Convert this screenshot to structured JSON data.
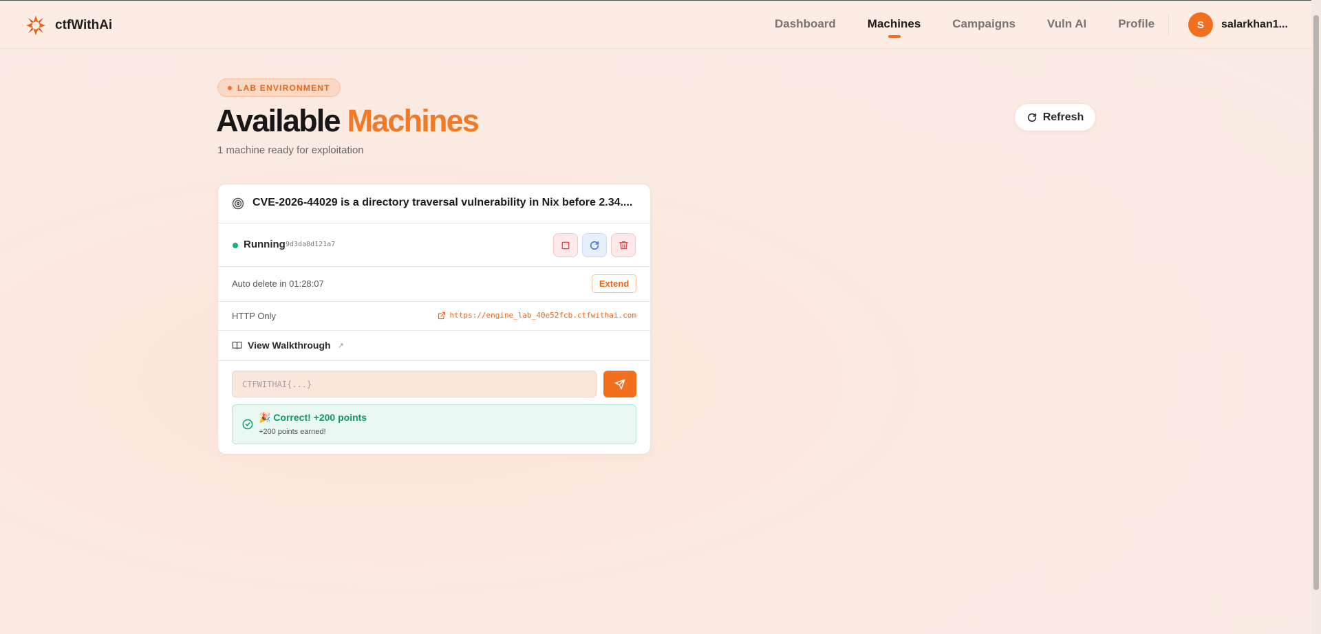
{
  "brand": {
    "name": "ctfWithAi"
  },
  "nav": {
    "items": [
      {
        "label": "Dashboard",
        "active": false
      },
      {
        "label": "Machines",
        "active": true
      },
      {
        "label": "Campaigns",
        "active": false
      },
      {
        "label": "Vuln AI",
        "active": false
      },
      {
        "label": "Profile",
        "active": false
      }
    ],
    "user": {
      "initial": "S",
      "name": "salarkhan1..."
    }
  },
  "header": {
    "badge": "LAB ENVIRONMENT",
    "title_main": "Available",
    "title_accent": "Machines",
    "subtitle": "1 machine ready for exploitation",
    "refresh_label": "Refresh"
  },
  "machine": {
    "title": "CVE-2026-44029 is a directory traversal vulnerability in Nix before 2.34....",
    "status": "Running",
    "id": "9d3da8d121a7",
    "timer_text": "Auto delete in 01:28:07",
    "extend_label": "Extend",
    "access_type": "HTTP Only",
    "url": "https://engine_lab_40e52fcb.ctfwithai.com",
    "walkthrough_label": "View Walkthrough",
    "walkthrough_arrow": "↗",
    "flag_placeholder": "CTFWITHAI{...}",
    "success_title": "🎉 Correct! +200 points",
    "success_sub": "+200 points earned!"
  },
  "colors": {
    "accent": "#f26f1e",
    "status_running": "#17b07c",
    "success": "#0e9a67"
  },
  "icons": [
    "logo-icon",
    "refresh-icon",
    "target-icon",
    "stop-icon",
    "restart-icon",
    "trash-icon",
    "external-link-icon",
    "book-icon",
    "send-icon",
    "check-circle-icon"
  ]
}
